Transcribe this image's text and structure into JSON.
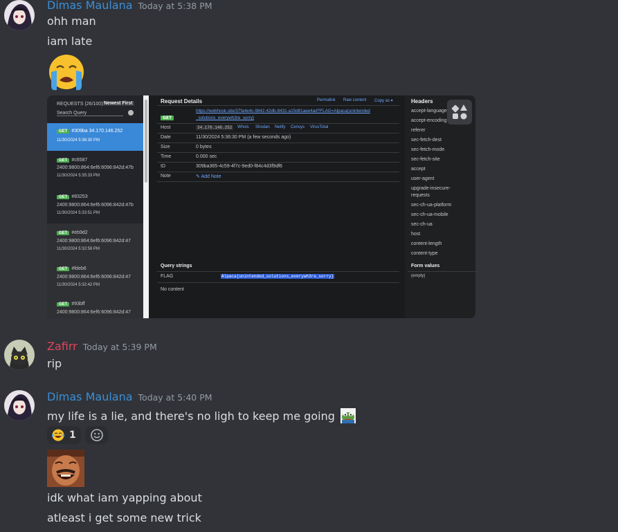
{
  "messages": [
    {
      "user": "Dimas Maulana",
      "user_color": "#3b8fd8",
      "time": "Today at 5:38 PM",
      "lines": [
        "ohh man",
        "iam late"
      ],
      "emoji": "loudly-crying-face"
    },
    {
      "user": "Zafirr",
      "user_color": "#e0455d",
      "time": "Today at 5:39 PM",
      "lines": [
        "rip"
      ]
    },
    {
      "user": "Dimas Maulana",
      "user_color": "#3b8fd8",
      "time": "Today at 5:40 PM",
      "lines": [
        "my life is a lie, and there's no ligh to keep me going",
        "idk what iam yapping about",
        "atleast i get some new trick"
      ],
      "reaction_count": "1"
    }
  ],
  "screenshot": {
    "requests_header": "REQUESTS (26/100)",
    "newest_first": "Newest First",
    "search_placeholder": "Search Query",
    "requests": [
      {
        "method": "GET",
        "id": "#309ba 34.170.146.252",
        "time": "11/30/2024 5:36:30 PM"
      },
      {
        "method": "GET",
        "id": "#c6587",
        "ip": "2400:9800:864:6ef6:6096:842d:47b",
        "time": "11/30/2024 5:35:33 PM"
      },
      {
        "method": "GET",
        "id": "#83253",
        "ip": "2400:9800:864:6ef6:6096:842d:47b",
        "time": "11/30/2024 5:33:51 PM"
      },
      {
        "method": "GET",
        "id": "#eb9d2",
        "ip": "2400:9800:864:6ef6:6096:842d:47",
        "time": "11/30/2024 5:32:58 PM"
      },
      {
        "method": "GET",
        "id": "#fdeb6",
        "ip": "2400:9800:864:6ef6:6096:842d:47",
        "time": "11/30/2024 5:32:42 PM"
      },
      {
        "method": "GET",
        "id": "#93bff",
        "ip": "2400:9800:864:6ef6:6096:842d:47"
      }
    ],
    "details": {
      "title": "Request Details",
      "permalink": "Permalink",
      "raw_content": "Raw content",
      "copy_as": "Copy as ▾",
      "method": "GET",
      "url_line1": "https://webhook.site/37fa4e4c-9842-42db-8431-a15d81aee4ad?FLAG=Alpaca{unintended",
      "url_line2": "_solutions_everywh3re_sorry}",
      "host_label": "Host",
      "host_ip": "34.170.146.252",
      "host_links": [
        "Whois",
        "Shodan",
        "Netify",
        "Censys",
        "VirusTotal"
      ],
      "date_label": "Date",
      "date_value": "11/30/2024 5:36:30 PM (a few seconds ago)",
      "size_label": "Size",
      "size_value": "0 bytes",
      "time_label": "Time",
      "time_value": "0.000 sec",
      "id_label": "ID",
      "id_value": "309ba365-4c59-4f7c-9ed0-f84c4d3f9df6",
      "note_label": "Note",
      "add_note": "Add Note",
      "query_title": "Query strings",
      "query_key": "FLAG",
      "query_value": "Alpaca{unintended_solutions_everywh3re_sorry}",
      "no_content": "No content"
    },
    "headers": {
      "title": "Headers",
      "items": [
        "accept-language",
        "accept-encoding",
        "referer",
        "sec-fetch-dest",
        "sec-fetch-mode",
        "sec-fetch-site",
        "accept",
        "user-agent",
        "upgrade-insecure-",
        "requests",
        "sec-ch-ua-platform",
        "sec-ch-ua-mobile",
        "sec-ch-ua",
        "host",
        "content-length",
        "content-type"
      ],
      "form_title": "Form values",
      "form_empty": "(empty)"
    }
  }
}
